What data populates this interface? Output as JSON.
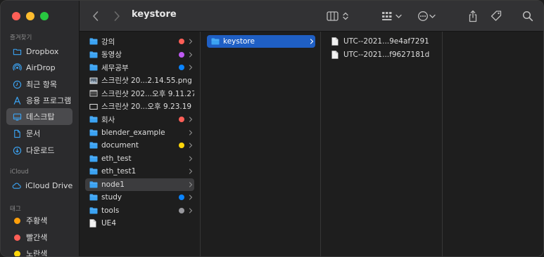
{
  "window": {
    "title": "keystore"
  },
  "toolbar": {
    "title": "keystore"
  },
  "colors": {
    "accent": "#1f5fc4",
    "folder": "#3ba3f3",
    "red": "#ff5f57",
    "purple": "#bf5af2",
    "blue": "#0a84ff",
    "yellow": "#ffd60a",
    "gray": "#98989d",
    "orange": "#ff9f0a"
  },
  "sidebar": {
    "favorites_label": "즐겨찾기",
    "favorites": [
      {
        "label": "Dropbox",
        "icon": "folder-icon"
      },
      {
        "label": "AirDrop",
        "icon": "airdrop-icon"
      },
      {
        "label": "최근 항목",
        "icon": "clock-icon"
      },
      {
        "label": "응용 프로그램",
        "icon": "applications-icon"
      },
      {
        "label": "데스크탑",
        "icon": "desktop-icon",
        "selected": true
      },
      {
        "label": "문서",
        "icon": "document-icon"
      },
      {
        "label": "다운로드",
        "icon": "download-icon"
      }
    ],
    "icloud_label": "iCloud",
    "icloud": [
      {
        "label": "iCloud Drive",
        "icon": "cloud-icon"
      }
    ],
    "tags_label": "태그",
    "tags": [
      {
        "label": "주황색",
        "color": "#ff9f0a"
      },
      {
        "label": "빨간색",
        "color": "#ff5f57"
      },
      {
        "label": "노란색",
        "color": "#ffd60a"
      }
    ]
  },
  "columns": {
    "col1": [
      {
        "label": "강의",
        "type": "folder",
        "tag": "#ff5f57",
        "chevron": true
      },
      {
        "label": "동영상",
        "type": "folder",
        "tag": "#bf5af2",
        "chevron": true
      },
      {
        "label": "세무공부",
        "type": "folder",
        "tag": "#0a84ff",
        "chevron": true
      },
      {
        "label": "스크린샷 20...2.14.55.png",
        "type": "image"
      },
      {
        "label": "스크린샷 202...오후 9.11.27",
        "type": "screenshot"
      },
      {
        "label": "스크린샷 20...오후 9.23.19",
        "type": "screenshot-empty"
      },
      {
        "label": "회사",
        "type": "folder",
        "tag": "#ff5f57",
        "chevron": true
      },
      {
        "label": "blender_example",
        "type": "folder",
        "chevron": true
      },
      {
        "label": "document",
        "type": "folder",
        "tag": "#ffd60a",
        "chevron": true
      },
      {
        "label": "eth_test",
        "type": "folder",
        "chevron": true
      },
      {
        "label": "eth_test1",
        "type": "folder",
        "chevron": true
      },
      {
        "label": "node1",
        "type": "folder",
        "chevron": true,
        "selected": true
      },
      {
        "label": "study",
        "type": "folder",
        "tag": "#0a84ff",
        "chevron": true
      },
      {
        "label": "tools",
        "type": "folder",
        "tag": "#98989d",
        "chevron": true
      },
      {
        "label": "UE4",
        "type": "file"
      }
    ],
    "col2": [
      {
        "label": "keystore",
        "type": "folder",
        "chevron": true,
        "selected": true
      }
    ],
    "col3": [
      {
        "label": "UTC--2021...9e4af7291",
        "type": "file"
      },
      {
        "label": "UTC--2021...f9627181d",
        "type": "file"
      }
    ]
  }
}
